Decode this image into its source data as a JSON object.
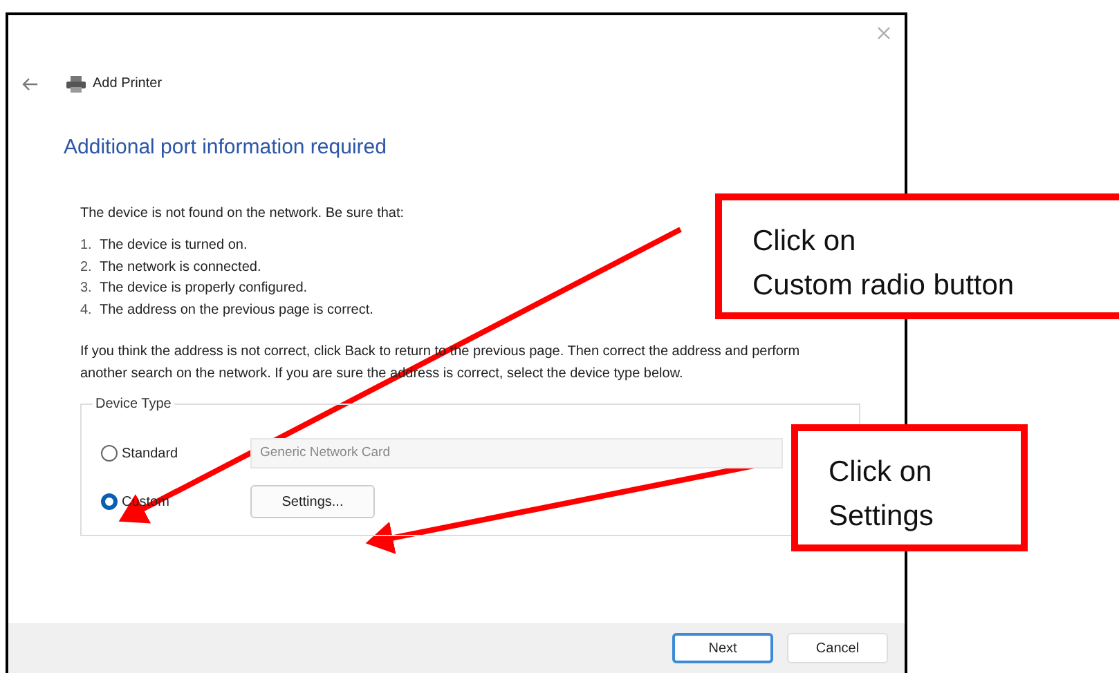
{
  "window": {
    "title": "Add Printer"
  },
  "heading": "Additional port information required",
  "intro": "The device is not found on the network.  Be sure that:",
  "checklist": [
    {
      "number": "1.",
      "text": "The device is turned on."
    },
    {
      "number": "2.",
      "text": "The network is connected."
    },
    {
      "number": "3.",
      "text": "The device is properly configured."
    },
    {
      "number": "4.",
      "text": "The address on the previous page is correct."
    }
  ],
  "paragraph": "If you think the address is not correct, click Back to return to the previous page.  Then correct the address and perform another search on the network.  If you are sure the address is correct, select the device type below.",
  "device_type": {
    "label": "Device Type",
    "options": [
      {
        "label": "Standard",
        "selected": false
      },
      {
        "label": "Custom",
        "selected": true
      }
    ],
    "standard_value": "Generic Network Card",
    "settings_button": "Settings..."
  },
  "buttons": [
    {
      "label": "Next",
      "default": true
    },
    {
      "label": "Cancel",
      "default": false
    }
  ],
  "annotations": [
    {
      "lines": [
        "Click on",
        "Custom radio button"
      ]
    },
    {
      "lines": [
        "Click on",
        "Settings"
      ]
    }
  ]
}
